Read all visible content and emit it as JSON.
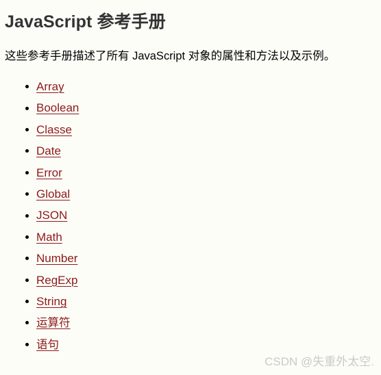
{
  "document": {
    "title": "JavaScript 参考手册",
    "intro": "这些参考手册描述了所有 JavaScript 对象的属性和方法以及示例。",
    "background_color": "#fdfdf8",
    "title_color": "#333333",
    "text_color": "#000000",
    "link_color": "#8b1a1a"
  },
  "reference_list": {
    "items": [
      {
        "label": "Array"
      },
      {
        "label": "Boolean"
      },
      {
        "label": "Classe"
      },
      {
        "label": "Date"
      },
      {
        "label": "Error"
      },
      {
        "label": "Global"
      },
      {
        "label": "JSON"
      },
      {
        "label": "Math"
      },
      {
        "label": "Number"
      },
      {
        "label": "RegExp"
      },
      {
        "label": "String"
      },
      {
        "label": "运算符"
      },
      {
        "label": "语句"
      }
    ]
  },
  "watermark": {
    "text": "CSDN @失重外太空.",
    "color": "#c9c9c9"
  }
}
